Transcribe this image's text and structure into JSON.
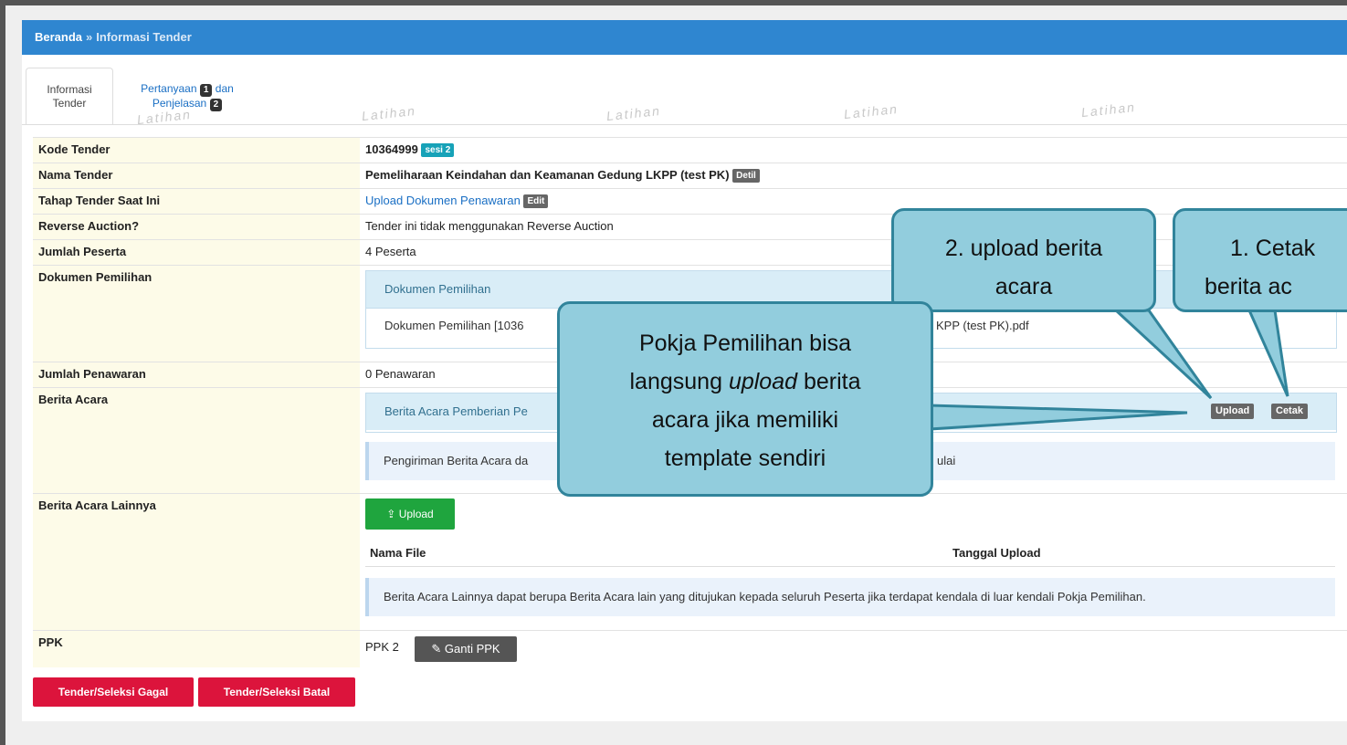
{
  "breadcrumb": {
    "home": "Beranda",
    "separator": "»",
    "current": "Informasi Tender"
  },
  "tabs": {
    "active_line1": "Informasi",
    "active_line2": "Tender",
    "other_prefix": "Pertanyaan",
    "other_badge1": "1",
    "other_mid": "dan",
    "other_line2": "Penjelasan",
    "other_badge2": "2"
  },
  "watermark": "Latihan",
  "fields": {
    "kode_label": "Kode Tender",
    "kode_value": "10364999",
    "kode_badge": "sesi 2",
    "nama_label": "Nama Tender",
    "nama_value": "Pemeliharaan Keindahan dan Keamanan Gedung LKPP (test PK)",
    "nama_badge": "Detil",
    "tahap_label": "Tahap Tender Saat Ini",
    "tahap_value": "Upload Dokumen Penawaran",
    "tahap_badge": "Edit",
    "reverse_label": "Reverse Auction?",
    "reverse_value": "Tender ini tidak menggunakan Reverse Auction",
    "peserta_label": "Jumlah Peserta",
    "peserta_value": "4 Peserta",
    "dok_label": "Dokumen Pemilihan",
    "dok_head": "Dokumen Pemilihan",
    "dok_file_left": "Dokumen Pemilihan [1036",
    "dok_file_right": "KPP (test PK).pdf",
    "penawaran_label": "Jumlah Penawaran",
    "penawaran_value": "0 Penawaran",
    "ba_label": "Berita Acara",
    "ba_head": "Berita Acara Pemberian Pe",
    "ba_upload": "Upload",
    "ba_cetak": "Cetak",
    "ba_info_left": "Pengiriman Berita Acara da",
    "ba_info_right": "ulai",
    "bal_label": "Berita Acara Lainnya",
    "bal_upload": "Upload",
    "bal_col1": "Nama File",
    "bal_col2": "Tanggal Upload",
    "bal_info": "Berita Acara Lainnya dapat berupa Berita Acara lain yang ditujukan kepada seluruh Peserta jika terdapat kendala di luar kendali Pokja Pemilihan.",
    "ppk_label": "PPK",
    "ppk_value": "PPK 2",
    "ppk_button": "Ganti PPK"
  },
  "actions": {
    "gagal": "Tender/Seleksi Gagal",
    "batal": "Tender/Seleksi Batal"
  },
  "callouts": {
    "c1_line1": "1. Cetak",
    "c1_line2": "berita ac",
    "c2_line1": "2. upload berita",
    "c2_line2": "acara",
    "c3_line1": "Pokja Pemilihan bisa",
    "c3_line2_pre": "langsung ",
    "c3_line2_em": "upload",
    "c3_line2_post": " berita",
    "c3_line3": "acara jika memiliki",
    "c3_line4": "template sendiri"
  },
  "colors": {
    "topbar": "#2f86d0",
    "callout_fill": "#92cddd",
    "callout_border": "#31849b",
    "danger": "#dc143c",
    "success": "#1fa53e"
  }
}
